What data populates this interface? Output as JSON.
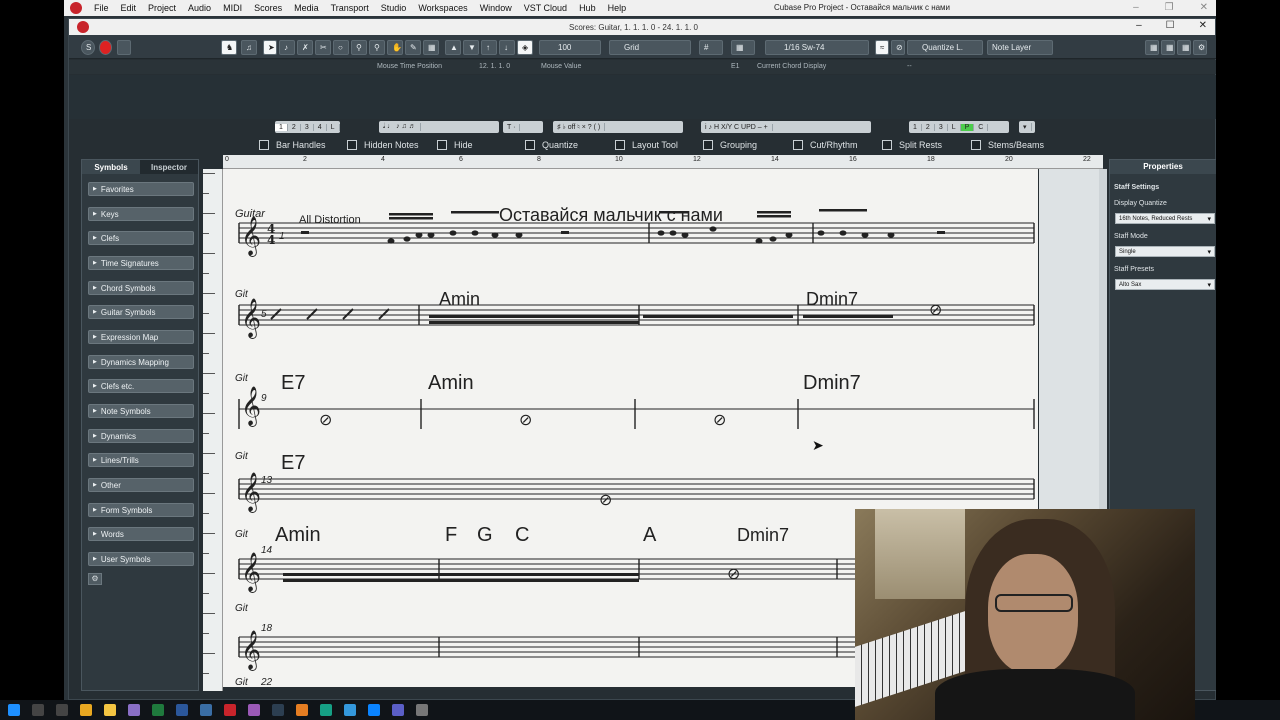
{
  "menubar": {
    "items": [
      "File",
      "Edit",
      "Project",
      "Audio",
      "MIDI",
      "Scores",
      "Media",
      "Transport",
      "Studio",
      "Workspaces",
      "Window",
      "VST Cloud",
      "Hub",
      "Help"
    ],
    "app_title": "Cubase Pro Project - Оставайся мальчик с нами"
  },
  "score_window": {
    "title": "Scores: Guitar, 1. 1. 1. 0 - 24. 1. 1. 0",
    "velocity": "100",
    "snap_mode": "Grid",
    "quantize": "1/16  Sw-74",
    "quantize_label": "Quantize L.",
    "note_layer": "Note Layer"
  },
  "infoline": {
    "mouse_time_label": "Mouse Time Position",
    "mouse_time_value": "12. 1. 1.  0",
    "mouse_value_label": "Mouse Value",
    "mouse_value": "E1",
    "chord_display_label": "Current Chord Display",
    "chord_display_value": "--"
  },
  "extended_toolbar": {
    "group1": [
      "1",
      "2",
      "3",
      "4",
      "L"
    ],
    "group2": [
      "1",
      "2",
      "3",
      "L",
      "P",
      "C"
    ],
    "checkboxes": [
      "Bar Handles",
      "Hidden Notes",
      "Hide",
      "Quantize",
      "Layout Tool",
      "Grouping",
      "Cut/Rhythm",
      "Split Rests",
      "Stems/Beams"
    ]
  },
  "left_panel": {
    "tab_symbols": "Symbols",
    "tab_inspector": "Inspector",
    "items": [
      "Favorites",
      "Keys",
      "Clefs",
      "Time Signatures",
      "Chord Symbols",
      "Guitar Symbols",
      "Expression Map",
      "Dynamics Mapping",
      "Clefs etc.",
      "Note Symbols",
      "Dynamics",
      "Lines/Trills",
      "Other",
      "Form Symbols",
      "Words",
      "User Symbols"
    ]
  },
  "ruler": {
    "marks": [
      "0",
      "2",
      "4",
      "6",
      "8",
      "10",
      "12",
      "14",
      "16",
      "18",
      "20",
      "22"
    ]
  },
  "score": {
    "instrument": "Guitar",
    "staff_label": "Git",
    "title": "Оставайся мальчик с нами",
    "subtitle": "All Distortion",
    "bar_numbers": [
      "1",
      "5",
      "9",
      "13",
      "14",
      "18",
      "22"
    ],
    "chords": {
      "c1": "Amin",
      "c2": "Dmin7",
      "c3": "E7",
      "c4": "Amin",
      "c5": "Dmin7",
      "c6": "E7",
      "c7": "Amin",
      "c8": "F",
      "c9": "G",
      "c10": "C",
      "c11": "A",
      "c12": "Dmin7"
    }
  },
  "properties": {
    "title": "Properties",
    "section": "Staff Settings",
    "display_quantize_label": "Display Quantize",
    "display_quantize_value": "16th Notes, Reduced Rests",
    "staff_mode_label": "Staff Mode",
    "staff_mode_value": "Single",
    "staff_presets_label": "Staff Presets",
    "staff_presets_value": "Alto Sax"
  },
  "colors": {
    "accent_red": "#c8242b",
    "panel_bg": "#2f393f",
    "paper": "#f3f3f1"
  }
}
